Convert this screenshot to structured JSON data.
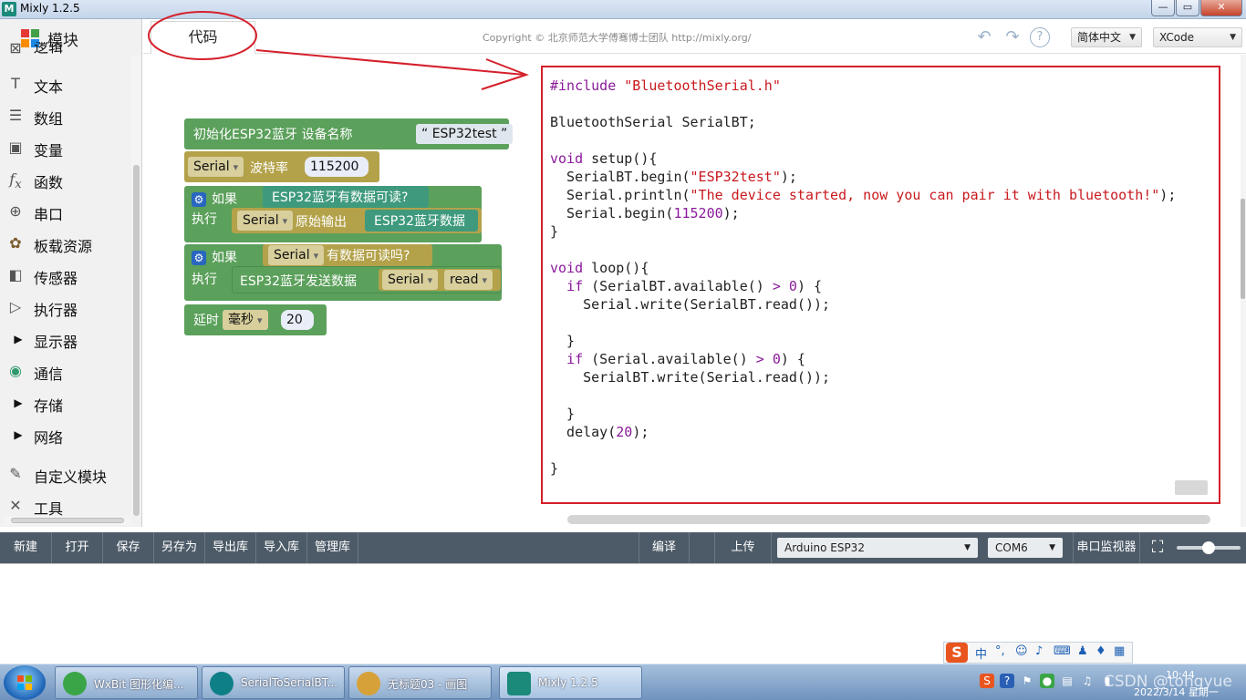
{
  "window": {
    "title": "Mixly 1.2.5",
    "app_icon": "M",
    "minimize": "—",
    "maximize": "▭",
    "close": "✕"
  },
  "sidebar": {
    "header": "模块",
    "partial_top": "逻辑",
    "items": [
      {
        "label": "文本",
        "icon": "text-icon"
      },
      {
        "label": "数组",
        "icon": "list-icon"
      },
      {
        "label": "变量",
        "icon": "variable-icon"
      },
      {
        "label": "函数",
        "icon": "function-icon"
      },
      {
        "label": "串口",
        "icon": "serial-icon"
      },
      {
        "label": "板载资源",
        "icon": "board-icon"
      },
      {
        "label": "传感器",
        "icon": "sensor-icon"
      },
      {
        "label": "执行器",
        "icon": "actuator-icon"
      },
      {
        "label": "显示器",
        "icon": "arrow-right-icon"
      },
      {
        "label": "通信",
        "icon": "antenna-icon"
      },
      {
        "label": "存储",
        "icon": "arrow-right-icon"
      },
      {
        "label": "网络",
        "icon": "arrow-right-icon"
      },
      {
        "label": "自定义模块",
        "icon": "pencil-icon"
      },
      {
        "label": "工具",
        "icon": "tools-icon"
      }
    ]
  },
  "topbar": {
    "tab_code": "代码",
    "copyright": "Copyright © 北京师范大学傅骞博士团队 http://mixly.org/",
    "language": "简体中文",
    "theme": "XCode"
  },
  "blocks": {
    "init_bt": "初始化ESP32蓝牙 设备名称",
    "device_name": "ESP32test",
    "serial": "Serial",
    "baud_label": "波特率",
    "baud": "115200",
    "if": "如果",
    "bt_available": "ESP32蓝牙有数据可读?",
    "do": "执行",
    "raw_output": "原始输出",
    "bt_data": "ESP32蓝牙数据",
    "serial_available": "有数据可读吗?",
    "bt_send": "ESP32蓝牙发送数据",
    "read": "read",
    "delay": "延时",
    "ms": "毫秒",
    "delay_value": "20"
  },
  "code": {
    "lines": [
      "#include \"BluetoothSerial.h\"",
      "",
      "BluetoothSerial SerialBT;",
      "",
      "void setup(){",
      "  SerialBT.begin(\"ESP32test\");",
      "  Serial.println(\"The device started, now you can pair it with bluetooth!\");",
      "  Serial.begin(115200);",
      "}",
      "",
      "void loop(){",
      "  if (SerialBT.available() > 0) {",
      "    Serial.write(SerialBT.read());",
      "",
      "  }",
      "  if (Serial.available() > 0) {",
      "    SerialBT.write(Serial.read());",
      "",
      "  }",
      "  delay(20);",
      "",
      "}"
    ]
  },
  "bottombar": {
    "new": "新建",
    "open": "打开",
    "save": "保存",
    "save_as": "另存为",
    "export_lib": "导出库",
    "import_lib": "导入库",
    "manage_lib": "管理库",
    "compile": "编译",
    "upload": "上传",
    "board": "Arduino ESP32",
    "port": "COM6",
    "serial_monitor": "串口监视器"
  },
  "ime": {
    "logo": "S",
    "mode": "中",
    "punct": "°,"
  },
  "taskbar": {
    "tasks": [
      {
        "label": "WxBit 图形化编...",
        "color": "#3aa546"
      },
      {
        "label": "SerialToSerialBT...",
        "color": "#0f7f86"
      },
      {
        "label": "无标题03 - 画图",
        "color": "#d7a13a"
      },
      {
        "label": "Mixly 1.2.5",
        "color": "#1b8a7a"
      }
    ],
    "time": "10:44",
    "date": "2022/3/14 星期一"
  },
  "watermark": "CSDN @tongyue",
  "colors": {
    "annotation_red": "#d4202b",
    "block_green": "#5ba05b",
    "block_olive": "#b3a24a",
    "toolbar": "#4d5b68"
  }
}
